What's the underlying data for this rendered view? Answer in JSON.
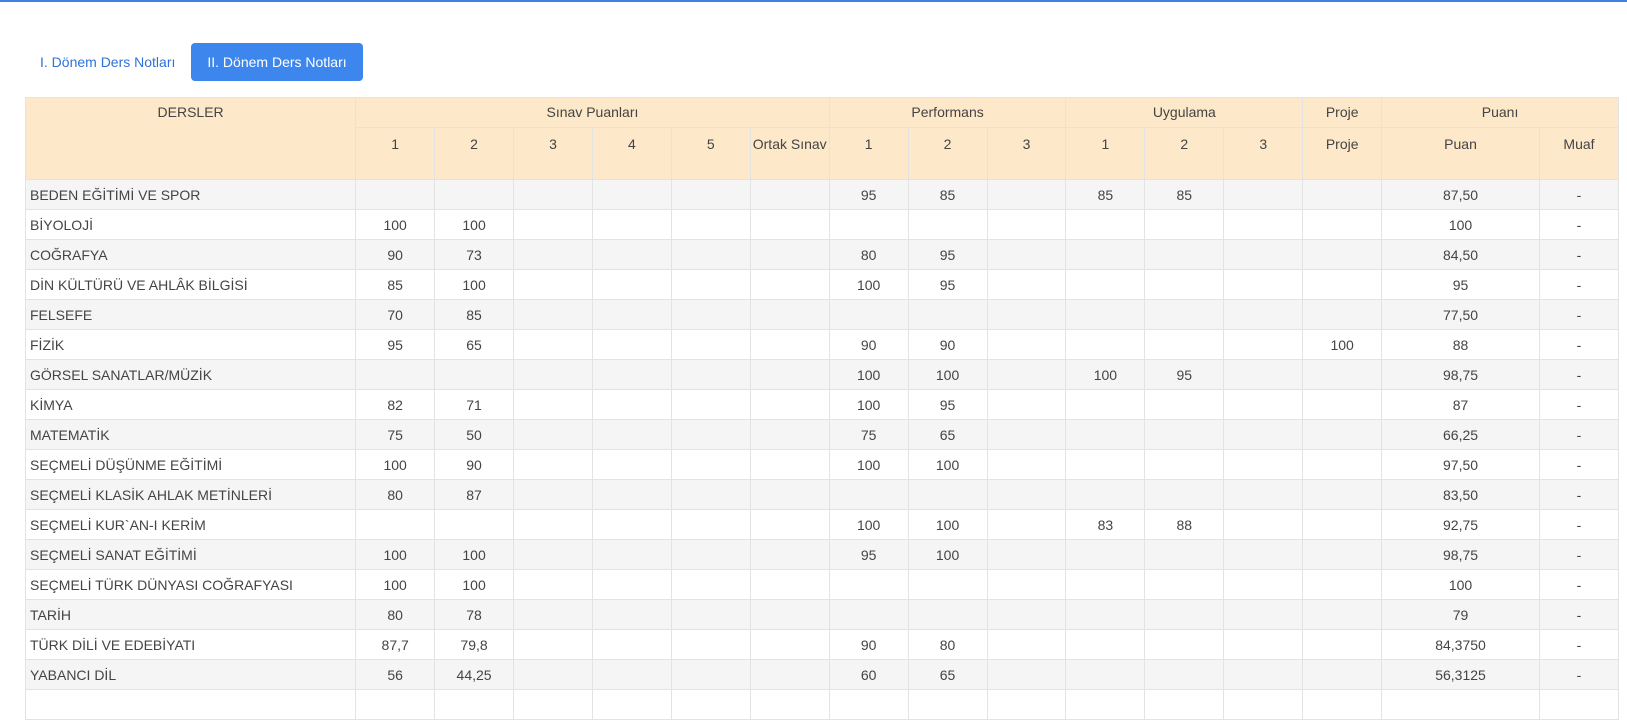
{
  "tabs": [
    {
      "label": "I. Dönem Ders Notları",
      "active": false
    },
    {
      "label": "II. Dönem Ders Notları",
      "active": true
    }
  ],
  "colors": {
    "accent": "#3d86ee",
    "header_bg": "#fde8c9",
    "top_bar": "#3f7fe6"
  },
  "table": {
    "group_headers": {
      "dersler": "DERSLER",
      "sinav": "Sınav Puanları",
      "performans": "Performans",
      "uygulama": "Uygulama",
      "proje": "Proje",
      "puani": "Puanı"
    },
    "sub_headers": {
      "sinav": [
        "1",
        "2",
        "3",
        "4",
        "5",
        "Ortak Sınav"
      ],
      "performans": [
        "1",
        "2",
        "3"
      ],
      "uygulama": [
        "1",
        "2",
        "3"
      ],
      "proje": [
        "Proje"
      ],
      "puani": [
        "Puan",
        "Muaf"
      ]
    },
    "rows": [
      [
        "BEDEN EĞİTİMİ VE SPOR",
        "",
        "",
        "",
        "",
        "",
        "",
        "95",
        "85",
        "",
        "85",
        "85",
        "",
        "",
        "87,50",
        "-"
      ],
      [
        "BİYOLOJİ",
        "100",
        "100",
        "",
        "",
        "",
        "",
        "",
        "",
        "",
        "",
        "",
        "",
        "",
        "100",
        "-"
      ],
      [
        "COĞRAFYA",
        "90",
        "73",
        "",
        "",
        "",
        "",
        "80",
        "95",
        "",
        "",
        "",
        "",
        "",
        "84,50",
        "-"
      ],
      [
        "DİN KÜLTÜRÜ VE AHLÂK BİLGİSİ",
        "85",
        "100",
        "",
        "",
        "",
        "",
        "100",
        "95",
        "",
        "",
        "",
        "",
        "",
        "95",
        "-"
      ],
      [
        "FELSEFE",
        "70",
        "85",
        "",
        "",
        "",
        "",
        "",
        "",
        "",
        "",
        "",
        "",
        "",
        "77,50",
        "-"
      ],
      [
        "FİZİK",
        "95",
        "65",
        "",
        "",
        "",
        "",
        "90",
        "90",
        "",
        "",
        "",
        "",
        "100",
        "88",
        "-"
      ],
      [
        "GÖRSEL SANATLAR/MÜZİK",
        "",
        "",
        "",
        "",
        "",
        "",
        "100",
        "100",
        "",
        "100",
        "95",
        "",
        "",
        "98,75",
        "-"
      ],
      [
        "KİMYA",
        "82",
        "71",
        "",
        "",
        "",
        "",
        "100",
        "95",
        "",
        "",
        "",
        "",
        "",
        "87",
        "-"
      ],
      [
        "MATEMATİK",
        "75",
        "50",
        "",
        "",
        "",
        "",
        "75",
        "65",
        "",
        "",
        "",
        "",
        "",
        "66,25",
        "-"
      ],
      [
        "SEÇMELİ DÜŞÜNME EĞİTİMİ",
        "100",
        "90",
        "",
        "",
        "",
        "",
        "100",
        "100",
        "",
        "",
        "",
        "",
        "",
        "97,50",
        "-"
      ],
      [
        "SEÇMELİ KLASİK AHLAK METİNLERİ",
        "80",
        "87",
        "",
        "",
        "",
        "",
        "",
        "",
        "",
        "",
        "",
        "",
        "",
        "83,50",
        "-"
      ],
      [
        "SEÇMELİ KUR`AN-I KERİM",
        "",
        "",
        "",
        "",
        "",
        "",
        "100",
        "100",
        "",
        "83",
        "88",
        "",
        "",
        "92,75",
        "-"
      ],
      [
        "SEÇMELİ SANAT EĞİTİMİ",
        "100",
        "100",
        "",
        "",
        "",
        "",
        "95",
        "100",
        "",
        "",
        "",
        "",
        "",
        "98,75",
        "-"
      ],
      [
        "SEÇMELİ TÜRK DÜNYASI COĞRAFYASI",
        "100",
        "100",
        "",
        "",
        "",
        "",
        "",
        "",
        "",
        "",
        "",
        "",
        "",
        "100",
        "-"
      ],
      [
        "TARİH",
        "80",
        "78",
        "",
        "",
        "",
        "",
        "",
        "",
        "",
        "",
        "",
        "",
        "",
        "79",
        "-"
      ],
      [
        "TÜRK DİLİ VE EDEBİYATI",
        "87,7",
        "79,8",
        "",
        "",
        "",
        "",
        "90",
        "80",
        "",
        "",
        "",
        "",
        "",
        "84,3750",
        "-"
      ],
      [
        "YABANCI DİL",
        "56",
        "44,25",
        "",
        "",
        "",
        "",
        "60",
        "65",
        "",
        "",
        "",
        "",
        "",
        "56,3125",
        "-"
      ],
      [
        "",
        "",
        "",
        "",
        "",
        "",
        "",
        "",
        "",
        "",
        "",
        "",
        "",
        "",
        "",
        ""
      ]
    ]
  }
}
